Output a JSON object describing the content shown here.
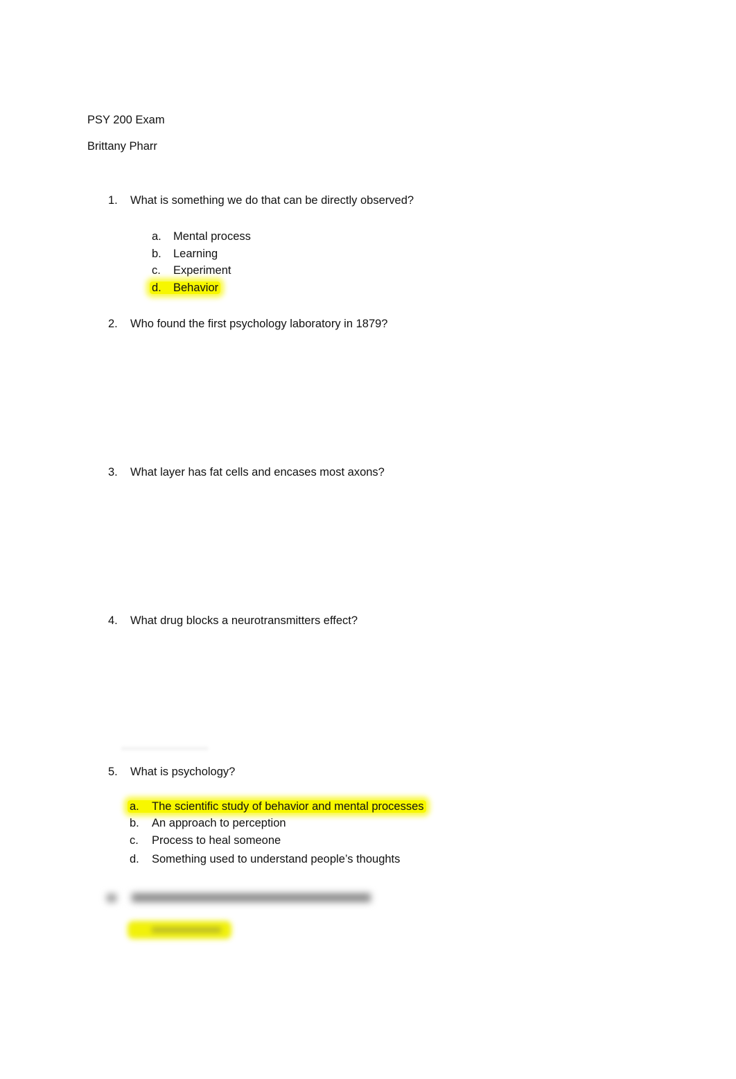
{
  "document": {
    "title": "PSY 200 Exam",
    "author": "Brittany Pharr",
    "highlight_color": "#f7f700",
    "questions": [
      {
        "number": "1.",
        "text": "What is something we do that can be directly observed?",
        "options": [
          {
            "letter": "a.",
            "text": "Mental process",
            "highlighted": false
          },
          {
            "letter": "b.",
            "text": "Learning",
            "highlighted": false
          },
          {
            "letter": "c.",
            "text": "Experiment",
            "highlighted": false
          },
          {
            "letter": "d.",
            "text": "Behavior",
            "highlighted": true
          }
        ]
      },
      {
        "number": "2.",
        "text": "Who found the first psychology laboratory in 1879?",
        "options": []
      },
      {
        "number": "3.",
        "text": "What layer has fat cells and encases most axons?",
        "options": []
      },
      {
        "number": "4.",
        "text": "What drug blocks a neurotransmitters effect?",
        "options": []
      },
      {
        "number": "5.",
        "text": "What is psychology?",
        "options": [
          {
            "letter": "a.",
            "text": "The scientific study of behavior and mental processes",
            "highlighted": true
          },
          {
            "letter": "b.",
            "text": "An approach to perception",
            "highlighted": false
          },
          {
            "letter": "c.",
            "text": "Process to heal someone",
            "highlighted": false
          },
          {
            "letter": "d.",
            "text": "Something used to understand people’s thoughts",
            "highlighted": false
          }
        ]
      }
    ],
    "blurred_section": {
      "note": "obscured content"
    }
  }
}
